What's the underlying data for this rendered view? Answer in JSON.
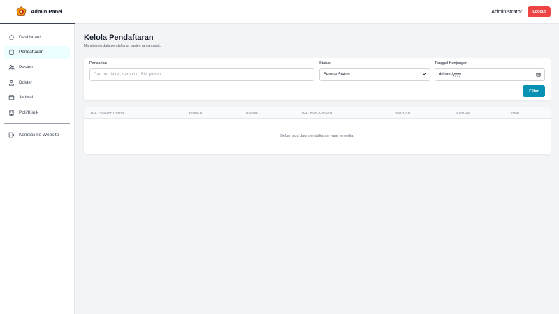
{
  "app": {
    "title": "Admin Panel",
    "user": "Administrator",
    "logout_label": "Logout",
    "colors": {
      "accent": "#0891b2",
      "danger": "#ef4444",
      "active_bg": "#ecfeff",
      "logo_gold": "#f59e0b",
      "logo_red": "#b91c1c"
    }
  },
  "sidebar": {
    "items": [
      {
        "label": "Dashboard",
        "icon": "home-icon",
        "active": false
      },
      {
        "label": "Pendaftaran",
        "icon": "clipboard-icon",
        "active": true
      },
      {
        "label": "Pasien",
        "icon": "users-icon",
        "active": false
      },
      {
        "label": "Dokter",
        "icon": "doctor-icon",
        "active": false
      },
      {
        "label": "Jadwal",
        "icon": "calendar-icon",
        "active": false
      },
      {
        "label": "Poli/Klinik",
        "icon": "building-icon",
        "active": false
      }
    ],
    "back_label": "Kembali ke Website",
    "back_icon": "exit-icon"
  },
  "page": {
    "title": "Kelola Pendaftaran",
    "subtitle": "Manajemen data pendaftaran pasien rumah sakit."
  },
  "filters": {
    "search_label": "Pencarian",
    "search_placeholder": "Cari no. daftar, nama/no. RM pasien...",
    "status_label": "Status",
    "status_value": "Semua Status",
    "date_label": "Tanggal Kunjungan",
    "date_value": "dd/mm/yyyy",
    "filter_button": "Filter"
  },
  "table": {
    "columns": [
      "NO. PENDAFTARAN",
      "PASIEN",
      "TUJUAN",
      "TGL. KUNJUNGAN",
      "ANTRIAN",
      "STATUS",
      "AKSI"
    ],
    "rows": [],
    "empty_message": "Belum ada data pendaftaran yang tersedia."
  }
}
